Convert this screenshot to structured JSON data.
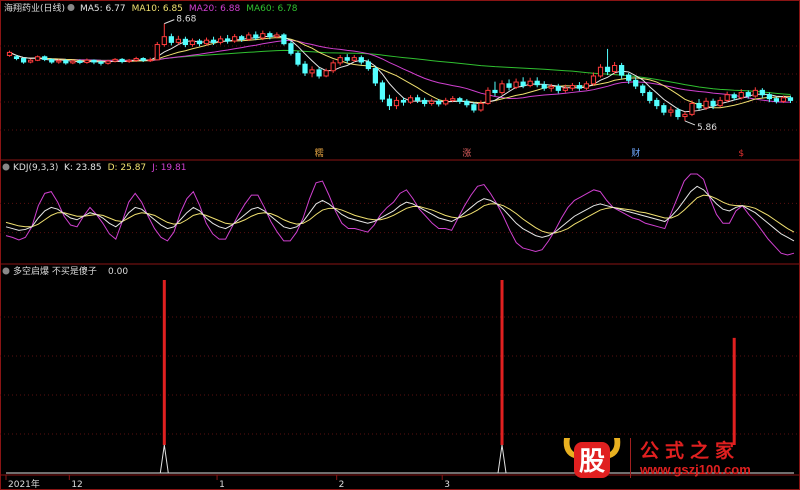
{
  "chart_data": [
    {
      "type": "candlestick",
      "title": "海翔药业(日线)",
      "legend": [
        {
          "name": "MA5",
          "value": "6.77",
          "color": "#e6e6e6"
        },
        {
          "name": "MA10",
          "value": "6.85",
          "color": "#f0e070"
        },
        {
          "name": "MA20",
          "value": "6.88",
          "color": "#d040d0"
        },
        {
          "name": "MA60",
          "value": "6.78",
          "color": "#30c030"
        }
      ],
      "ylim": [
        5.6,
        8.9
      ],
      "high_marker": "8.68",
      "low_marker": "5.86",
      "event_markers": [
        "糯",
        "涨",
        "财",
        "$"
      ],
      "candles": [
        [
          7.95,
          8.02,
          7.92,
          8.06
        ],
        [
          7.92,
          7.88,
          7.84,
          7.96
        ],
        [
          7.88,
          7.8,
          7.76,
          7.9
        ],
        [
          7.8,
          7.84,
          7.77,
          7.87
        ],
        [
          7.84,
          7.92,
          7.82,
          7.95
        ],
        [
          7.92,
          7.86,
          7.82,
          7.95
        ],
        [
          7.86,
          7.8,
          7.76,
          7.88
        ],
        [
          7.8,
          7.83,
          7.76,
          7.86
        ],
        [
          7.83,
          7.78,
          7.74,
          7.87
        ],
        [
          7.78,
          7.82,
          7.75,
          7.85
        ],
        [
          7.82,
          7.79,
          7.75,
          7.86
        ],
        [
          7.79,
          7.84,
          7.76,
          7.88
        ],
        [
          7.84,
          7.8,
          7.75,
          7.86
        ],
        [
          7.8,
          7.77,
          7.72,
          7.83
        ],
        [
          7.77,
          7.82,
          7.74,
          7.85
        ],
        [
          7.82,
          7.86,
          7.79,
          7.89
        ],
        [
          7.86,
          7.81,
          7.77,
          7.89
        ],
        [
          7.81,
          7.84,
          7.78,
          7.87
        ],
        [
          7.84,
          7.88,
          7.8,
          7.92
        ],
        [
          7.88,
          7.84,
          7.8,
          7.91
        ],
        [
          7.84,
          7.85,
          7.8,
          7.9
        ],
        [
          7.85,
          8.2,
          7.84,
          8.26
        ],
        [
          8.2,
          8.38,
          8.15,
          8.68
        ],
        [
          8.38,
          8.25,
          8.18,
          8.45
        ],
        [
          8.25,
          8.32,
          8.2,
          8.4
        ],
        [
          8.32,
          8.2,
          8.14,
          8.38
        ],
        [
          8.2,
          8.28,
          8.15,
          8.34
        ],
        [
          8.28,
          8.22,
          8.16,
          8.33
        ],
        [
          8.22,
          8.3,
          8.18,
          8.36
        ],
        [
          8.3,
          8.25,
          8.19,
          8.38
        ],
        [
          8.25,
          8.33,
          8.2,
          8.4
        ],
        [
          8.33,
          8.28,
          8.22,
          8.42
        ],
        [
          8.28,
          8.38,
          8.24,
          8.44
        ],
        [
          8.38,
          8.32,
          8.26,
          8.42
        ],
        [
          8.32,
          8.42,
          8.28,
          8.48
        ],
        [
          8.42,
          8.35,
          8.3,
          8.5
        ],
        [
          8.35,
          8.45,
          8.3,
          8.52
        ],
        [
          8.45,
          8.38,
          8.32,
          8.5
        ],
        [
          8.38,
          8.42,
          8.34,
          8.48
        ],
        [
          8.42,
          8.22,
          8.18,
          8.46
        ],
        [
          8.22,
          8.0,
          7.95,
          8.28
        ],
        [
          8.0,
          7.75,
          7.7,
          8.05
        ],
        [
          7.75,
          7.55,
          7.48,
          7.82
        ],
        [
          7.55,
          7.62,
          7.45,
          7.7
        ],
        [
          7.62,
          7.48,
          7.42,
          7.68
        ],
        [
          7.48,
          7.6,
          7.45,
          7.65
        ],
        [
          7.6,
          7.78,
          7.55,
          7.84
        ],
        [
          7.78,
          7.9,
          7.72,
          7.96
        ],
        [
          7.9,
          7.84,
          7.78,
          7.98
        ],
        [
          7.84,
          7.9,
          7.8,
          7.96
        ],
        [
          7.9,
          7.8,
          7.74,
          7.95
        ],
        [
          7.8,
          7.65,
          7.6,
          7.86
        ],
        [
          7.65,
          7.32,
          7.25,
          7.7
        ],
        [
          7.32,
          6.95,
          6.88,
          7.38
        ],
        [
          6.95,
          6.8,
          6.7,
          7.05
        ],
        [
          6.8,
          6.92,
          6.72,
          7.0
        ],
        [
          6.92,
          6.88,
          6.8,
          6.98
        ],
        [
          6.88,
          6.98,
          6.84,
          7.04
        ],
        [
          6.98,
          6.92,
          6.86,
          7.05
        ],
        [
          6.92,
          6.85,
          6.78,
          6.98
        ],
        [
          6.85,
          6.9,
          6.8,
          6.96
        ],
        [
          6.9,
          6.84,
          6.78,
          6.95
        ],
        [
          6.84,
          6.92,
          6.8,
          6.98
        ],
        [
          6.92,
          6.96,
          6.88,
          7.02
        ],
        [
          6.96,
          6.9,
          6.84,
          7.0
        ],
        [
          6.9,
          6.82,
          6.76,
          6.95
        ],
        [
          6.82,
          6.7,
          6.64,
          6.88
        ],
        [
          6.7,
          6.85,
          6.66,
          6.92
        ],
        [
          6.85,
          7.15,
          6.82,
          7.22
        ],
        [
          7.15,
          7.1,
          7.02,
          7.35
        ],
        [
          7.1,
          7.3,
          7.05,
          7.38
        ],
        [
          7.3,
          7.22,
          7.15,
          7.4
        ],
        [
          7.22,
          7.34,
          7.18,
          7.42
        ],
        [
          7.34,
          7.26,
          7.2,
          7.45
        ],
        [
          7.26,
          7.36,
          7.22,
          7.44
        ],
        [
          7.36,
          7.28,
          7.22,
          7.45
        ],
        [
          7.28,
          7.2,
          7.14,
          7.36
        ],
        [
          7.2,
          7.24,
          7.12,
          7.3
        ],
        [
          7.24,
          7.15,
          7.08,
          7.3
        ],
        [
          7.15,
          7.2,
          7.1,
          7.28
        ],
        [
          7.2,
          7.26,
          7.14,
          7.32
        ],
        [
          7.26,
          7.2,
          7.14,
          7.34
        ],
        [
          7.2,
          7.3,
          7.16,
          7.36
        ],
        [
          7.3,
          7.48,
          7.26,
          7.56
        ],
        [
          7.48,
          7.68,
          7.44,
          7.75
        ],
        [
          7.68,
          7.58,
          7.5,
          8.1
        ],
        [
          7.58,
          7.72,
          7.52,
          7.8
        ],
        [
          7.72,
          7.5,
          7.42,
          7.78
        ],
        [
          7.5,
          7.38,
          7.3,
          7.55
        ],
        [
          7.38,
          7.25,
          7.18,
          7.45
        ],
        [
          7.25,
          7.1,
          7.02,
          7.3
        ],
        [
          7.1,
          6.92,
          6.85,
          7.15
        ],
        [
          6.92,
          6.8,
          6.72,
          6.98
        ],
        [
          6.8,
          6.65,
          6.58,
          6.86
        ],
        [
          6.65,
          6.7,
          6.55,
          6.78
        ],
        [
          6.7,
          6.55,
          6.48,
          6.75
        ],
        [
          6.55,
          6.6,
          6.45,
          6.66
        ],
        [
          6.6,
          6.85,
          6.56,
          6.92
        ],
        [
          6.85,
          6.75,
          6.7,
          6.95
        ],
        [
          6.75,
          6.9,
          6.7,
          6.98
        ],
        [
          6.9,
          6.8,
          6.72,
          6.96
        ],
        [
          6.8,
          6.92,
          6.76,
          7.0
        ],
        [
          6.92,
          7.05,
          6.88,
          7.12
        ],
        [
          7.05,
          6.98,
          6.92,
          7.1
        ],
        [
          6.98,
          7.1,
          6.94,
          7.18
        ],
        [
          7.1,
          7.02,
          6.96,
          7.15
        ],
        [
          7.02,
          7.15,
          6.98,
          7.22
        ],
        [
          7.15,
          7.05,
          6.98,
          7.2
        ],
        [
          7.05,
          6.96,
          6.88,
          7.1
        ],
        [
          6.96,
          6.9,
          6.85,
          7.0
        ],
        [
          6.9,
          6.98,
          6.86,
          7.03
        ],
        [
          6.98,
          6.92,
          6.86,
          7.03
        ]
      ]
    },
    {
      "type": "line",
      "title": "KDJ(9,3,3)",
      "legend": [
        {
          "name": "K",
          "value": "23.85",
          "color": "#e6e6e6"
        },
        {
          "name": "D",
          "value": "25.87",
          "color": "#f0e070"
        },
        {
          "name": "J",
          "value": "19.81",
          "color": "#d040d0"
        }
      ],
      "ylim": [
        0,
        100
      ],
      "series": [
        {
          "name": "K",
          "color": "#e6e6e6",
          "values": [
            40,
            38,
            36,
            37,
            40,
            50,
            58,
            62,
            60,
            55,
            50,
            48,
            52,
            56,
            54,
            50,
            44,
            40,
            46,
            56,
            62,
            60,
            54,
            48,
            42,
            38,
            40,
            48,
            56,
            62,
            58,
            50,
            44,
            40,
            38,
            42,
            48,
            54,
            60,
            62,
            58,
            52,
            46,
            40,
            38,
            40,
            46,
            56,
            66,
            70,
            66,
            60,
            54,
            50,
            48,
            46,
            44,
            46,
            50,
            54,
            58,
            64,
            68,
            66,
            62,
            58,
            54,
            50,
            48,
            46,
            50,
            56,
            62,
            68,
            72,
            70,
            66,
            60,
            52,
            44,
            38,
            34,
            30,
            28,
            30,
            34,
            40,
            46,
            52,
            56,
            60,
            64,
            66,
            64,
            62,
            60,
            58,
            56,
            54,
            52,
            50,
            48,
            46,
            52,
            60,
            70,
            80,
            86,
            82,
            74,
            66,
            60,
            58,
            62,
            64,
            60,
            56,
            50,
            44,
            38,
            32,
            28,
            24
          ]
        },
        {
          "name": "D",
          "color": "#f0e070",
          "values": [
            45,
            43,
            41,
            40,
            40,
            43,
            48,
            53,
            56,
            56,
            54,
            52,
            52,
            53,
            54,
            53,
            50,
            47,
            46,
            50,
            54,
            56,
            55,
            53,
            49,
            45,
            43,
            44,
            48,
            53,
            55,
            53,
            50,
            47,
            44,
            43,
            45,
            48,
            52,
            55,
            56,
            55,
            52,
            48,
            45,
            43,
            44,
            48,
            54,
            59,
            61,
            61,
            59,
            56,
            53,
            51,
            49,
            48,
            48,
            50,
            53,
            57,
            61,
            63,
            63,
            61,
            59,
            56,
            53,
            51,
            50,
            52,
            55,
            59,
            64,
            66,
            66,
            64,
            60,
            55,
            49,
            44,
            39,
            35,
            33,
            33,
            35,
            38,
            43,
            47,
            51,
            55,
            59,
            61,
            62,
            61,
            60,
            59,
            57,
            56,
            54,
            52,
            50,
            50,
            53,
            59,
            66,
            73,
            76,
            75,
            72,
            68,
            65,
            64,
            64,
            63,
            61,
            57,
            53,
            48,
            43,
            38,
            34
          ]
        },
        {
          "name": "J",
          "color": "#d040d0",
          "values": [
            30,
            28,
            25,
            28,
            40,
            64,
            78,
            80,
            68,
            52,
            42,
            40,
            52,
            62,
            54,
            44,
            32,
            26,
            46,
            68,
            78,
            68,
            52,
            38,
            28,
            24,
            34,
            56,
            72,
            80,
            64,
            44,
            32,
            26,
            26,
            40,
            54,
            66,
            76,
            76,
            62,
            46,
            34,
            24,
            24,
            34,
            50,
            72,
            90,
            92,
            76,
            58,
            44,
            38,
            38,
            36,
            34,
            42,
            54,
            62,
            68,
            78,
            82,
            72,
            60,
            52,
            44,
            38,
            38,
            36,
            50,
            64,
            76,
            86,
            88,
            78,
            66,
            52,
            36,
            22,
            16,
            14,
            12,
            14,
            24,
            36,
            50,
            62,
            70,
            74,
            78,
            82,
            80,
            70,
            62,
            58,
            54,
            50,
            48,
            44,
            42,
            40,
            38,
            56,
            74,
            92,
            100,
            100,
            94,
            72,
            54,
            44,
            44,
            58,
            64,
            54,
            46,
            36,
            26,
            18,
            10,
            8,
            10
          ]
        }
      ]
    },
    {
      "type": "bar",
      "title": "多空启爆 不买是傻子",
      "value": "0.00",
      "color": "#e02020",
      "ylim": [
        0,
        1
      ],
      "signals": [
        {
          "index": 22,
          "value": 1
        },
        {
          "index": 70,
          "value": 1
        },
        {
          "index": 103,
          "value": 0.7
        }
      ],
      "x_ticks": [
        {
          "index": 0,
          "label": "2021年"
        },
        {
          "index": 9,
          "label": "12"
        },
        {
          "index": 30,
          "label": "1"
        },
        {
          "index": 47,
          "label": "2"
        },
        {
          "index": 62,
          "label": "3"
        }
      ]
    }
  ],
  "watermark": {
    "logo_char": "股",
    "title": "公式之家",
    "url": "www.gszj100.com",
    "color": "#e02020"
  }
}
